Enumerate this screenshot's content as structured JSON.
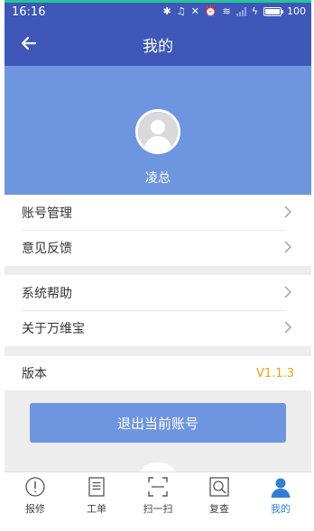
{
  "status_bar": {
    "time": "16:16",
    "battery": "100",
    "battery_level": 1.0
  },
  "navbar": {
    "title": "我的"
  },
  "profile": {
    "name": "凌总"
  },
  "menu_groups": [
    {
      "items": [
        {
          "label": "账号管理"
        },
        {
          "label": "意见反馈"
        }
      ]
    },
    {
      "items": [
        {
          "label": "系统帮助"
        },
        {
          "label": "关于万维宝"
        }
      ]
    }
  ],
  "version": {
    "label": "版本",
    "value": "V1.1.3"
  },
  "logout": {
    "label": "退出当前账号"
  },
  "tabs": [
    {
      "label": "报修",
      "icon": "alert-circle-icon"
    },
    {
      "label": "工单",
      "icon": "document-icon"
    },
    {
      "label": "扫一扫",
      "icon": "scan-icon"
    },
    {
      "label": "复查",
      "icon": "search-icon"
    },
    {
      "label": "我的",
      "icon": "user-icon",
      "active": true
    }
  ],
  "colors": {
    "header": "#3f57b8",
    "profile_bg": "#6d95e0",
    "version_accent": "#f2a20c",
    "active_tab": "#2f7fd8",
    "top_accent": "#27c49a"
  }
}
